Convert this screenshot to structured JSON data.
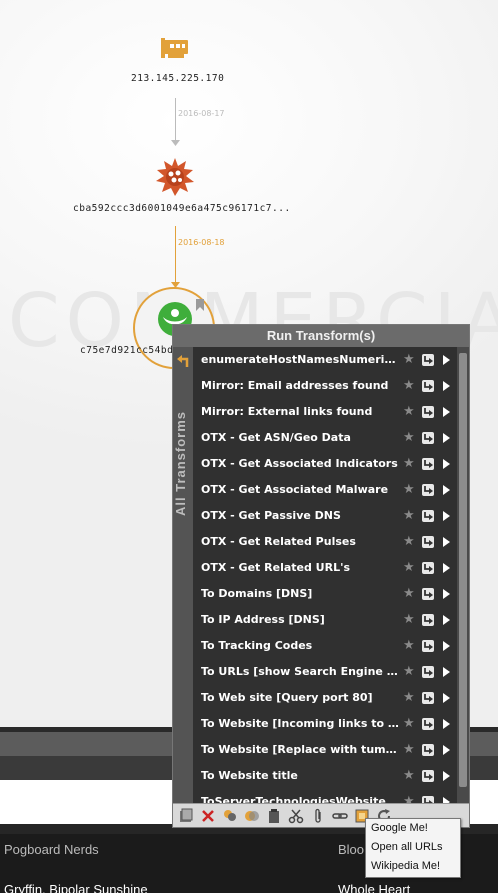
{
  "graph": {
    "watermark": "COMMERCIAL",
    "nodes": [
      {
        "label": "213.145.225.170",
        "icon": "network-card-icon"
      },
      {
        "label": "cba592ccc3d6001049e6a475c96171c7...",
        "icon": "malware-icon"
      },
      {
        "label": "c75e7d921cc54bd",
        "icon": "otx-pulse-icon"
      }
    ],
    "edges": [
      {
        "label": "2016-08-17",
        "color": "#bbbbbb"
      },
      {
        "label": "2016-08-18",
        "color": "#e2a13a"
      }
    ]
  },
  "popup": {
    "title": "Run Transform(s)",
    "side_tab_label": "All Transforms",
    "items": [
      {
        "label": "enumerateHostNamesNumerically"
      },
      {
        "label": "Mirror: Email addresses found"
      },
      {
        "label": "Mirror: External links found"
      },
      {
        "label": "OTX - Get ASN/Geo Data"
      },
      {
        "label": "OTX - Get Associated Indicators"
      },
      {
        "label": "OTX - Get Associated Malware"
      },
      {
        "label": "OTX - Get Passive DNS"
      },
      {
        "label": "OTX - Get Related Pulses"
      },
      {
        "label": "OTX - Get Related URL's"
      },
      {
        "label": "To Domains [DNS]"
      },
      {
        "label": "To IP Address [DNS]"
      },
      {
        "label": "To Tracking Codes"
      },
      {
        "label": "To URLs [show Search Engine res..."
      },
      {
        "label": "To Web site [Query port 80]"
      },
      {
        "label": "To Website [Incoming links to site]"
      },
      {
        "label": "To Website [Replace with tumbnail]"
      },
      {
        "label": "To Website title"
      },
      {
        "label": "ToServerTechnologiesWebsite"
      }
    ],
    "toolbar_icons": [
      "export-icon",
      "delete-icon",
      "paint-icon",
      "merge-icon",
      "clipboard-icon",
      "scissors-icon",
      "paperclip-icon",
      "link-icon",
      "highlight-icon",
      "refresh-icon"
    ]
  },
  "submenu": {
    "items": [
      "Google Me!",
      "Open all URLs",
      "Wikipedia Me!"
    ]
  },
  "list": {
    "rows": [
      {
        "left": "Pogboard Nerds",
        "right": "Bloo..."
      },
      {
        "left": "Gryffin, Bipolar Sunshine",
        "right": "Whole Heart"
      }
    ]
  },
  "colors": {
    "accent": "#e2a13a",
    "popup_bg": "#3b3b3b",
    "header_bg": "#6b6b6b"
  }
}
